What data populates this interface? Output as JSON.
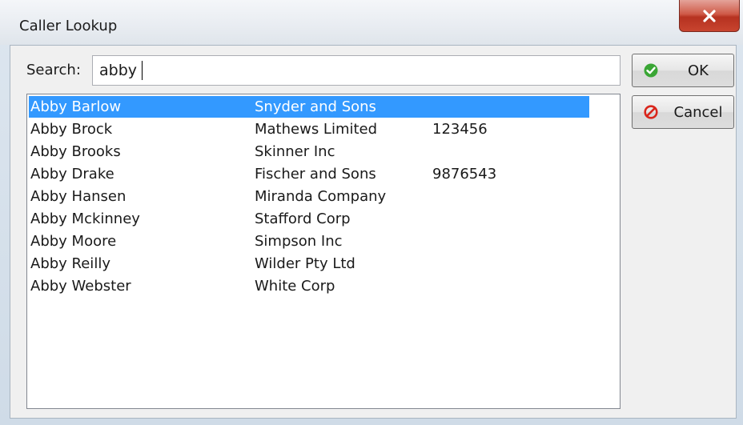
{
  "window": {
    "title": "Caller Lookup",
    "close_glyph": "X"
  },
  "search": {
    "label": "Search:",
    "value": "abby"
  },
  "buttons": {
    "ok_label": "OK",
    "ok_icon": "check-circle-icon",
    "cancel_label": "Cancel",
    "cancel_icon": "no-entry-icon"
  },
  "results": [
    {
      "name": "Abby Barlow",
      "company": "Snyder and Sons",
      "phone": "",
      "selected": true
    },
    {
      "name": "Abby Brock",
      "company": "Mathews Limited",
      "phone": "123456",
      "selected": false
    },
    {
      "name": "Abby Brooks",
      "company": "Skinner Inc",
      "phone": "",
      "selected": false
    },
    {
      "name": "Abby Drake",
      "company": "Fischer and Sons",
      "phone": "9876543",
      "selected": false
    },
    {
      "name": "Abby Hansen",
      "company": "Miranda Company",
      "phone": "",
      "selected": false
    },
    {
      "name": "Abby Mckinney",
      "company": "Stafford Corp",
      "phone": "",
      "selected": false
    },
    {
      "name": "Abby Moore",
      "company": "Simpson Inc",
      "phone": "",
      "selected": false
    },
    {
      "name": "Abby Reilly",
      "company": "Wilder Pty Ltd",
      "phone": "",
      "selected": false
    },
    {
      "name": "Abby Webster",
      "company": "White Corp",
      "phone": "",
      "selected": false
    }
  ],
  "colors": {
    "selection": "#3399ff",
    "ok_icon": "#3aa635",
    "cancel_icon": "#d9261c",
    "close_button": "#c8442f"
  }
}
